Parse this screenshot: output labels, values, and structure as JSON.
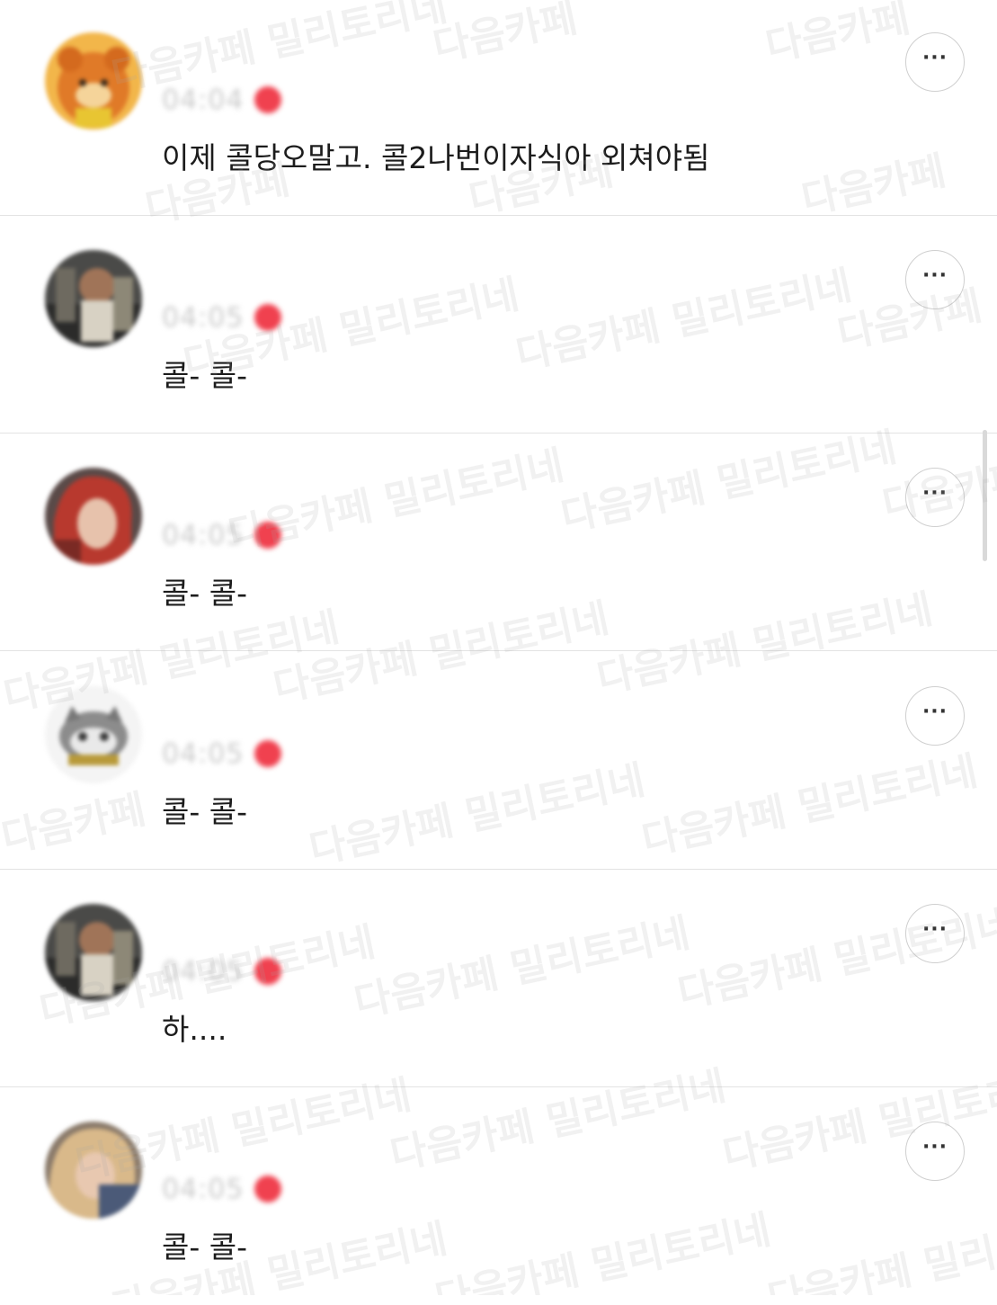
{
  "comments": [
    {
      "time": "04:04",
      "text": "이제 콜당오말고. 콜2나번이자식아 외쳐야됨",
      "more_label": "···",
      "avatar": "orange-bear",
      "accent": "#f0414f"
    },
    {
      "time": "04:05",
      "text": "콜- 콜-",
      "more_label": "···",
      "avatar": "person-dark",
      "accent": "#f0414f"
    },
    {
      "time": "04:05",
      "text": "콜- 콜-",
      "more_label": "···",
      "avatar": "person-red-hair",
      "accent": "#f0414f"
    },
    {
      "time": "04:05",
      "text": "콜- 콜-",
      "more_label": "···",
      "avatar": "cat-sticker",
      "accent": "#f0414f"
    },
    {
      "time": "04:05",
      "text": "하....",
      "more_label": "···",
      "avatar": "person-dark",
      "accent": "#f0414f"
    },
    {
      "time": "04:05",
      "text": "콜- 콜-",
      "more_label": "···",
      "avatar": "person-blonde",
      "accent": "#f0414f"
    }
  ],
  "watermark": {
    "line1": "다음카페 밀리토리네",
    "line2": "다음카페"
  }
}
